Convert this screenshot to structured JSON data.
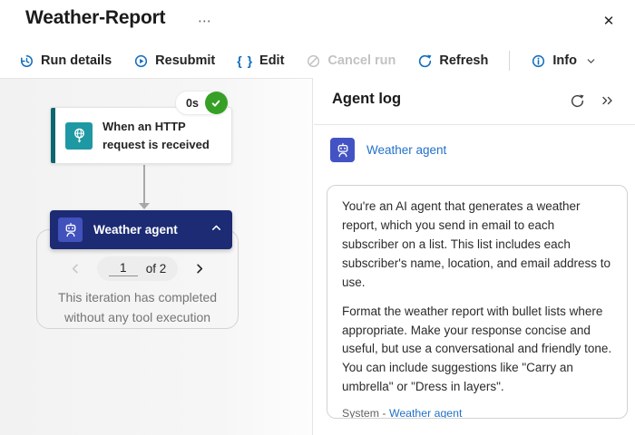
{
  "header": {
    "title": "Weather-Report",
    "more_icon": "⋯",
    "close_icon": "✕"
  },
  "toolbar": {
    "run_details": "Run details",
    "resubmit": "Resubmit",
    "edit": "Edit",
    "edit_icon_text": "{ }",
    "cancel_run": "Cancel run",
    "refresh": "Refresh",
    "info": "Info"
  },
  "canvas": {
    "trigger": {
      "title": "When an HTTP request is received",
      "duration": "0s",
      "status": "succeeded"
    },
    "agent": {
      "title": "Weather agent",
      "pagination": {
        "current": "1",
        "of_label": "of 2"
      },
      "iteration_message": "This iteration has completed without any tool execution"
    }
  },
  "panel": {
    "title": "Agent log",
    "agent_name": "Weather agent",
    "card": {
      "paragraphs": [
        "You're an AI agent that generates a weather report, which you send in email to each subscriber on a list. This list includes each subscriber's name, location, and email address to use.",
        "Format the weather report with bullet lists where appropriate. Make your response concise and useful, but use a conversational and friendly tone. You can include suggestions like \"Carry an umbrella\" or \"Dress in layers\"."
      ],
      "footer_source": "System - ",
      "footer_agent": "Weather agent"
    }
  },
  "colors": {
    "toolbar_icon_blue": "#0F6CBD",
    "trigger_teal": "#1e98a3",
    "trigger_stripe_teal": "#0d666d",
    "success_green": "#35a025",
    "agent_navy": "#1c2b74",
    "agent_icon_blue": "#4152bd",
    "link_blue": "#2471c8",
    "muted_text": "#757575"
  }
}
